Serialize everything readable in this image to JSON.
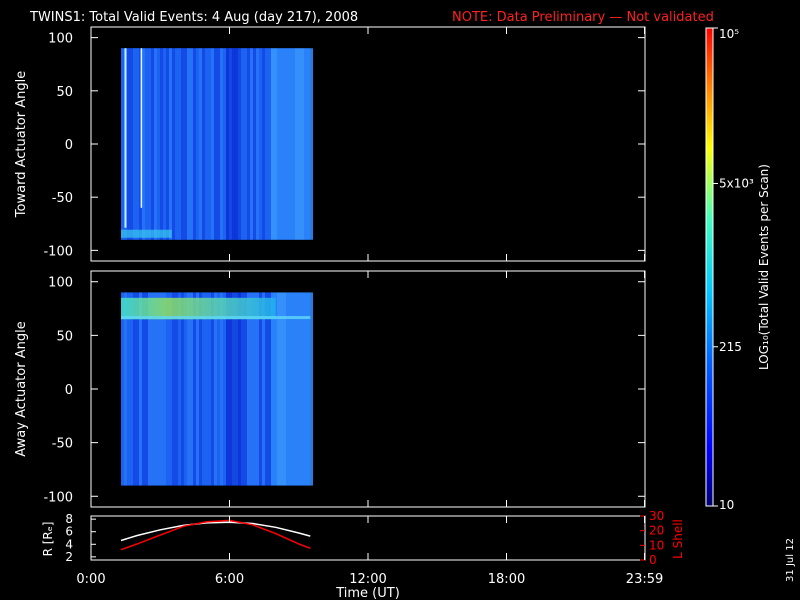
{
  "header": {
    "title": "TWINS1: Total Valid Events:  4 Aug (day 217), 2008",
    "note": "NOTE: Data Preliminary — Not validated",
    "note_color": "#ff2020"
  },
  "footer": {
    "date_stamp": "31 Jul 12"
  },
  "colorbar": {
    "label": "LOG₁₀(Total Valid Events per Scan)",
    "tick_labels": [
      "10",
      "215",
      "5x10³",
      "10⁵"
    ],
    "tick_values": [
      10,
      215,
      5000,
      100000
    ],
    "scale": "log",
    "colormap": [
      "#000070",
      "#0000ff",
      "#0060ff",
      "#00c8ff",
      "#40ffc0",
      "#ffff00",
      "#ff8000",
      "#ff0000"
    ]
  },
  "chart_data": [
    {
      "type": "heatmap",
      "panel": "top",
      "ylabel": "Toward Actuator Angle",
      "ylim": [
        -110,
        110
      ],
      "yticks": [
        100,
        50,
        0,
        -50,
        -100
      ],
      "xlim": [
        0,
        24
      ],
      "data_time_range": [
        1.3,
        9.5
      ],
      "data_angle_range": [
        -90,
        90
      ],
      "dominant_level": 215
    },
    {
      "type": "heatmap",
      "panel": "middle",
      "ylabel": "Away Actuator Angle",
      "ylim": [
        -110,
        110
      ],
      "yticks": [
        100,
        50,
        0,
        -50,
        -100
      ],
      "xlim": [
        0,
        24
      ],
      "data_time_range": [
        1.3,
        9.5
      ],
      "data_angle_range": [
        -90,
        90
      ],
      "dominant_level": 215,
      "enhanced_band": {
        "angle_range": [
          65,
          85
        ],
        "time_range": [
          1.3,
          8.0
        ],
        "level": 2000
      }
    },
    {
      "type": "line",
      "panel": "bottom",
      "ylabel": "R [Rₑ]",
      "ylabel2": "L Shell",
      "ylim": [
        1.5,
        8.5
      ],
      "yticks": [
        2,
        4,
        6,
        8
      ],
      "ylim2": [
        0,
        30
      ],
      "yticks2": [
        0,
        10,
        20,
        30
      ],
      "xlabel": "Time (UT)",
      "xlim": [
        0,
        24
      ],
      "xtick_labels": [
        "0:00",
        "6:00",
        "12:00",
        "18:00",
        "23:59"
      ],
      "xtick_values": [
        0,
        6,
        12,
        18,
        23.98
      ],
      "series": [
        {
          "color": "#ffffff",
          "axis": "left",
          "x": [
            1.3,
            2,
            3,
            4,
            5,
            6,
            7,
            8,
            9,
            9.5
          ],
          "y": [
            4.6,
            5.4,
            6.3,
            7.0,
            7.4,
            7.5,
            7.3,
            6.7,
            5.8,
            5.3
          ]
        },
        {
          "color": "#ff0000",
          "axis": "right",
          "x": [
            1.3,
            2,
            3,
            4,
            5,
            6,
            7,
            8,
            9,
            9.5
          ],
          "y": [
            7,
            11,
            17,
            23,
            26,
            27,
            24,
            18,
            11,
            8
          ]
        }
      ]
    }
  ]
}
